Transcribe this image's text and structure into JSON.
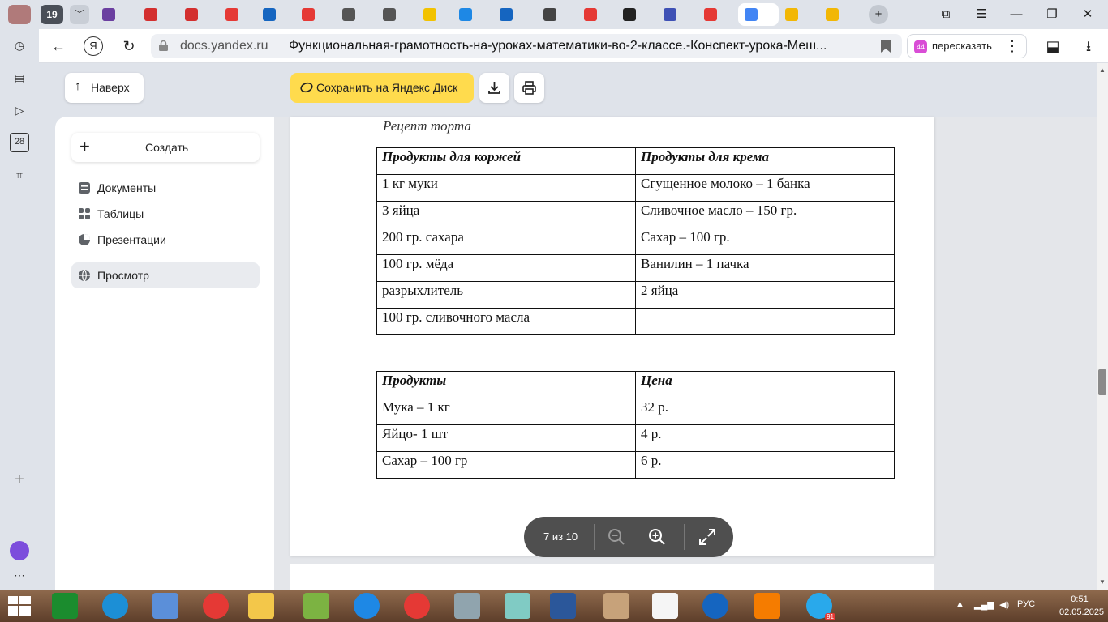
{
  "browser": {
    "tab_count": "19",
    "tabs": [
      {
        "name": "tab-1",
        "color": "#6b3fa0"
      },
      {
        "name": "tab-2",
        "color": "#d32f2f"
      },
      {
        "name": "tab-3",
        "color": "#d32f2f"
      },
      {
        "name": "tab-4",
        "color": "#e53935"
      },
      {
        "name": "tab-5",
        "color": "#1565c0"
      },
      {
        "name": "tab-6",
        "color": "#e53935"
      },
      {
        "name": "tab-7",
        "color": "#555555"
      },
      {
        "name": "tab-8",
        "color": "#555555"
      },
      {
        "name": "tab-9",
        "color": "#f2c200"
      },
      {
        "name": "tab-10",
        "color": "#1e88e5"
      },
      {
        "name": "tab-11",
        "color": "#1565c0"
      },
      {
        "name": "tab-12",
        "color": "#444444"
      },
      {
        "name": "tab-13",
        "color": "#e53935"
      },
      {
        "name": "tab-14",
        "color": "#222222"
      },
      {
        "name": "tab-15",
        "color": "#3f51b5"
      },
      {
        "name": "tab-16",
        "color": "#e53935"
      },
      {
        "name": "tab-17-active",
        "color": "#4285f4"
      },
      {
        "name": "tab-18",
        "color": "#f2b705"
      },
      {
        "name": "tab-19",
        "color": "#f2b705"
      }
    ],
    "address": {
      "domain": "docs.yandex.ru",
      "title": "Функциональная-грамотность-на-уроках-математики-во-2-классе.-Конспект-урока-Меш..."
    },
    "retell_label": "пересказать",
    "retell_badge": "44"
  },
  "toolbar": {
    "up_label": "Наверх",
    "save_label": "Сохранить на Яндекс Диск"
  },
  "sidebar": {
    "create_label": "Создать",
    "items": [
      {
        "label": "Документы",
        "icon": "document-icon"
      },
      {
        "label": "Таблицы",
        "icon": "table-icon"
      },
      {
        "label": "Презентации",
        "icon": "presentation-icon"
      },
      {
        "label": "Просмотр",
        "icon": "globe-icon"
      }
    ]
  },
  "document": {
    "caption": "Рецепт торта",
    "table1": {
      "headers": [
        "Продукты для коржей",
        "Продукты для крема"
      ],
      "rows": [
        [
          "1 кг муки",
          "Сгущенное молоко – 1 банка"
        ],
        [
          "3 яйца",
          "Сливочное масло – 150 гр."
        ],
        [
          "200 гр. сахара",
          "Сахар – 100 гр."
        ],
        [
          "100 гр. мёда",
          "Ванилин – 1 пачка"
        ],
        [
          "разрыхлитель",
          "2 яйца"
        ],
        [
          "100 гр. сливочного масла",
          ""
        ]
      ]
    },
    "table2": {
      "headers": [
        "Продукты",
        "Цена"
      ],
      "rows": [
        [
          "Мука – 1 кг",
          "32  р."
        ],
        [
          "Яйцо- 1 шт",
          "4 р."
        ],
        [
          "Сахар – 100 гр",
          "6  р."
        ]
      ]
    }
  },
  "viewer": {
    "page_indicator": "7 из 10"
  },
  "taskbar": {
    "language": "РУС",
    "time": "0:51",
    "date": "02.05.2025",
    "telegram_badge": "91"
  }
}
